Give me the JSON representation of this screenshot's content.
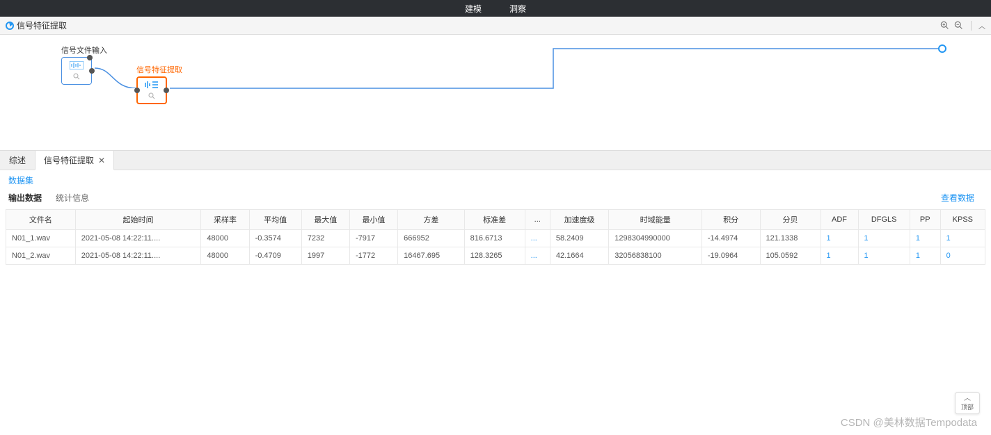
{
  "topNav": {
    "item1": "建模",
    "item2": "洞察"
  },
  "titleBar": {
    "title": "信号特征提取"
  },
  "canvas": {
    "node1": {
      "label": "信号文件输入"
    },
    "node2": {
      "label": "信号特征提取"
    }
  },
  "tabs": {
    "tab1": "综述",
    "tab2": "信号特征提取"
  },
  "subTabs": {
    "dataset": "数据集",
    "output": "输出数据",
    "stats": "统计信息",
    "viewData": "查看数据"
  },
  "table": {
    "headers": [
      "文件名",
      "起始时间",
      "采样率",
      "平均值",
      "最大值",
      "最小值",
      "方差",
      "标准差",
      "...",
      "加速度级",
      "时域能量",
      "积分",
      "分贝",
      "ADF",
      "DFGLS",
      "PP",
      "KPSS"
    ],
    "rows": [
      [
        "N01_1.wav",
        "2021-05-08 14:22:11....",
        "48000",
        "-0.3574",
        "7232",
        "-7917",
        "666952",
        "816.6713",
        "...",
        "58.2409",
        "1298304990000",
        "-14.4974",
        "121.1338",
        "1",
        "1",
        "1",
        "1"
      ],
      [
        "N01_2.wav",
        "2021-05-08 14:22:11....",
        "48000",
        "-0.4709",
        "1997",
        "-1772",
        "16467.695",
        "128.3265",
        "...",
        "42.1664",
        "32056838100",
        "-19.0964",
        "105.0592",
        "1",
        "1",
        "1",
        "0"
      ]
    ]
  },
  "scrollTop": "顶部",
  "watermark": "CSDN @美林数据Tempodata"
}
